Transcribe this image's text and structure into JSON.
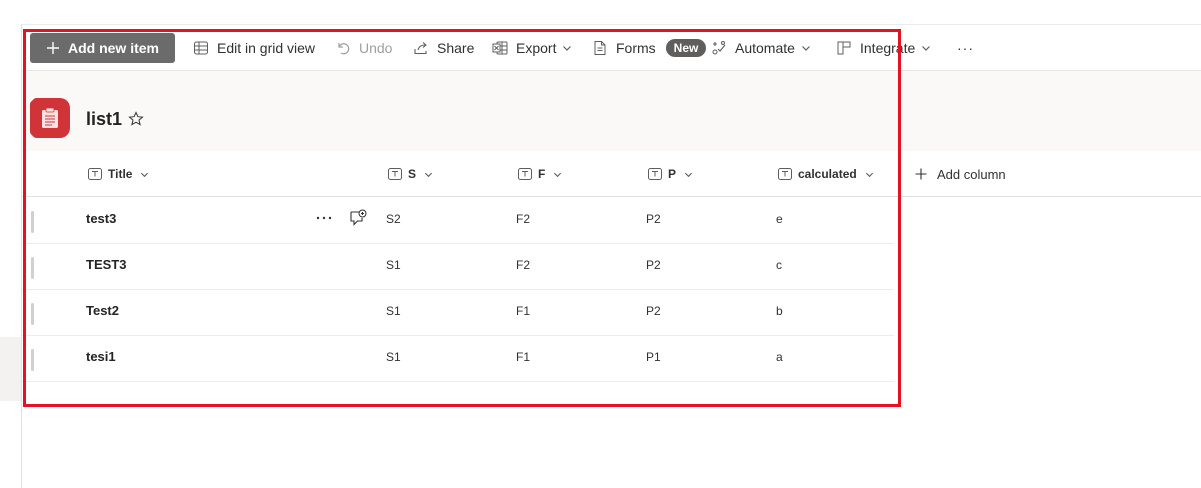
{
  "toolbar": {
    "add_new_item": "Add new item",
    "edit_grid": "Edit in grid view",
    "undo": "Undo",
    "share": "Share",
    "export": "Export",
    "forms": "Forms",
    "forms_badge": "New",
    "automate": "Automate",
    "integrate": "Integrate",
    "more": "···"
  },
  "list": {
    "title": "list1",
    "icon_color": "#d13438"
  },
  "columns": {
    "title": "Title",
    "s": "S",
    "f": "F",
    "p": "P",
    "calculated": "calculated",
    "add_column": "Add column"
  },
  "rows": [
    {
      "title": "test3",
      "s": "S2",
      "f": "F2",
      "p": "P2",
      "calculated": "e"
    },
    {
      "title": "TEST3",
      "s": "S1",
      "f": "F2",
      "p": "P2",
      "calculated": "c"
    },
    {
      "title": "Test2",
      "s": "S1",
      "f": "F1",
      "p": "P2",
      "calculated": "b"
    },
    {
      "title": "tesi1",
      "s": "S1",
      "f": "F1",
      "p": "P1",
      "calculated": "a"
    }
  ],
  "highlight_color": "#e81123"
}
